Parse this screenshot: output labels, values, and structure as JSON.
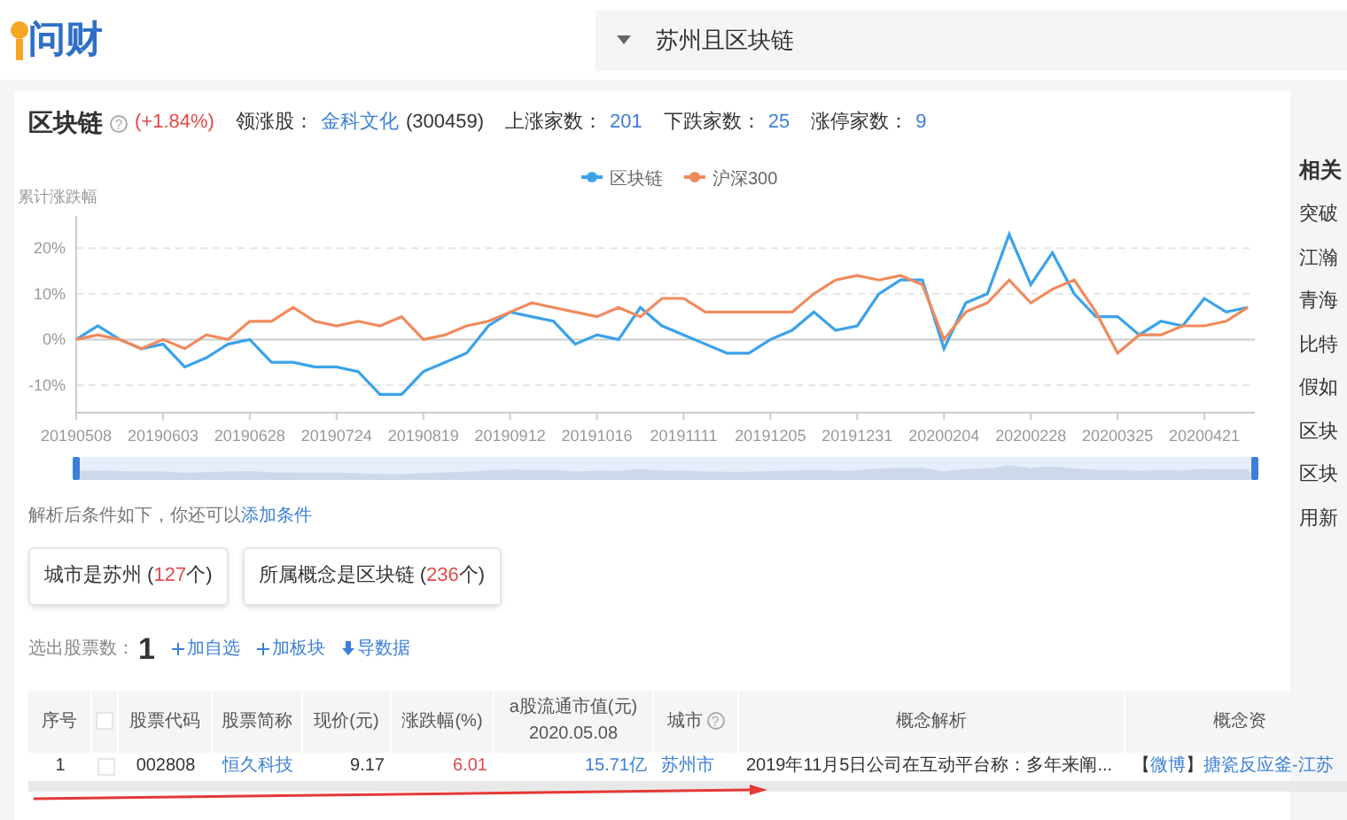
{
  "header": {
    "logo": "问财",
    "query": "苏州且区块链"
  },
  "summary": {
    "name": "区块链",
    "help": "?",
    "change": "(+1.84%)",
    "leader_label": "领涨股：",
    "leader_name": "金科文化",
    "leader_code": "(300459)",
    "stats": [
      {
        "label": "上涨家数：",
        "value": "201"
      },
      {
        "label": "下跌家数：",
        "value": "25"
      },
      {
        "label": "涨停家数：",
        "value": "9"
      }
    ]
  },
  "chart": {
    "chart_data": {
      "type": "line",
      "ylabel": "累计涨跌幅",
      "ylim": [
        -16,
        27
      ],
      "grid": true,
      "legend": "top",
      "categories": [
        "20190508",
        null,
        null,
        null,
        "20190603",
        null,
        null,
        null,
        "20190628",
        null,
        null,
        null,
        "20190724",
        null,
        null,
        null,
        "20190819",
        null,
        null,
        null,
        "20190912",
        null,
        null,
        null,
        "20191016",
        null,
        null,
        null,
        "20191111",
        null,
        null,
        null,
        "20191205",
        null,
        null,
        null,
        "20191231",
        null,
        null,
        null,
        "20200204",
        null,
        null,
        null,
        "20200228",
        null,
        null,
        null,
        "20200325",
        null,
        null,
        null,
        "20200421",
        null,
        null
      ],
      "series": [
        {
          "name": "区块链",
          "color": "#3ba2ea",
          "values": [
            0,
            3,
            0,
            -2,
            -1,
            -6,
            -4,
            -1,
            0,
            -5,
            -5,
            -6,
            -6,
            -7,
            -12,
            -12,
            -7,
            -5,
            -3,
            3,
            6,
            5,
            4,
            -1,
            1,
            0,
            7,
            3,
            1,
            -1,
            -3,
            -3,
            0,
            2,
            6,
            2,
            3,
            10,
            13,
            13,
            -2,
            8,
            10,
            23,
            12,
            19,
            10,
            5,
            5,
            1,
            4,
            3,
            9,
            6,
            7
          ]
        },
        {
          "name": "沪深300",
          "color": "#f08a5d",
          "values": [
            0,
            1,
            0,
            -2,
            0,
            -2,
            1,
            0,
            4,
            4,
            7,
            4,
            3,
            4,
            3,
            5,
            0,
            1,
            3,
            4,
            6,
            8,
            7,
            6,
            5,
            7,
            5,
            9,
            9,
            6,
            6,
            6,
            6,
            6,
            10,
            13,
            14,
            13,
            14,
            12,
            0,
            6,
            8,
            13,
            8,
            11,
            13,
            6,
            -3,
            1,
            1,
            3,
            3,
            4,
            7
          ]
        }
      ],
      "yticks": [
        {
          "value": -10,
          "label": "-10%"
        },
        {
          "value": 0,
          "label": "0%"
        },
        {
          "value": 10,
          "label": "10%"
        },
        {
          "value": 20,
          "label": "20%"
        }
      ]
    }
  },
  "news": {
    "title": "相关",
    "items": [
      "突破",
      "江瀚",
      "青海",
      "比特",
      "假如",
      "区块",
      "区块",
      "用新"
    ]
  },
  "conditions": {
    "intro": "解析后条件如下，你还可以",
    "add_link": "添加条件",
    "chips": [
      {
        "text": "城市是苏州 (",
        "count": "127",
        "unit": "个)"
      },
      {
        "text": "所属概念是区块链 (",
        "count": "236",
        "unit": "个)"
      }
    ]
  },
  "results": {
    "label": "选出股票数：",
    "count": "1",
    "actions": [
      {
        "kind": "plus",
        "text": "加自选"
      },
      {
        "kind": "plus",
        "text": "加板块"
      },
      {
        "kind": "download",
        "text": "导数据"
      }
    ]
  },
  "table": {
    "select_all_checked": false,
    "city_help": "?",
    "columns": [
      "序号",
      "",
      "股票代码",
      "股票简称",
      "现价(元)",
      "涨跌幅(%)",
      "a股流通市值(元)\n2020.05.08",
      "城市",
      "概念解析",
      "概念资"
    ],
    "rows": [
      {
        "index": "1",
        "checked": false,
        "code": "002808",
        "name": "恒久科技",
        "price": "9.17",
        "change": "6.01",
        "cap": "15.71亿",
        "city": "苏州市",
        "analysis": "2019年11月5日公司在互动平台称：多年来阐...",
        "source_open": "【",
        "source_tag": "微博",
        "source_close": "】",
        "source_text": "搪瓷反应釜-江苏"
      }
    ]
  }
}
